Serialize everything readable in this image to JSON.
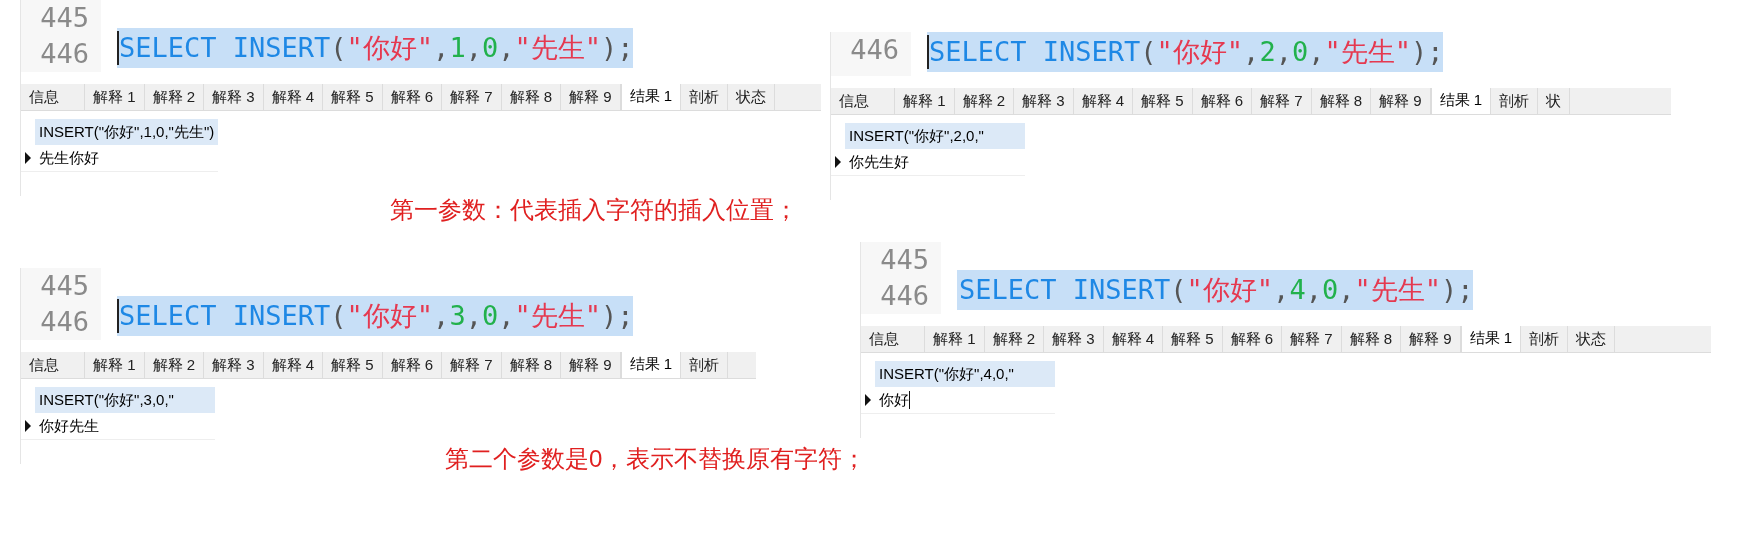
{
  "panels": [
    {
      "line_numbers": [
        "445",
        "446"
      ],
      "caret": true,
      "code": [
        {
          "kind": "keyword",
          "text": "SELECT INSERT"
        },
        {
          "kind": "punct",
          "text": "("
        },
        {
          "kind": "string",
          "text": "\"你好\""
        },
        {
          "kind": "punct",
          "text": ","
        },
        {
          "kind": "number",
          "text": "1"
        },
        {
          "kind": "punct",
          "text": ","
        },
        {
          "kind": "number",
          "text": "0"
        },
        {
          "kind": "punct",
          "text": ","
        },
        {
          "kind": "string",
          "text": "\"先生\""
        },
        {
          "kind": "punct",
          "text": ");"
        }
      ],
      "tabs": [
        {
          "label": "信息",
          "selected": false
        },
        {
          "label": "解释 1",
          "selected": false
        },
        {
          "label": "解释 2",
          "selected": false
        },
        {
          "label": "解释 3",
          "selected": false
        },
        {
          "label": "解释 4",
          "selected": false
        },
        {
          "label": "解释 5",
          "selected": false
        },
        {
          "label": "解释 6",
          "selected": false
        },
        {
          "label": "解释 7",
          "selected": false
        },
        {
          "label": "解释 8",
          "selected": false
        },
        {
          "label": "解释 9",
          "selected": false
        },
        {
          "label": "结果 1",
          "selected": true
        },
        {
          "label": "剖析",
          "selected": false
        },
        {
          "label": "状态",
          "selected": false
        }
      ],
      "result": {
        "column": "INSERT(\"你好\",1,0,\"先生\")",
        "value": "先生你好",
        "cursor": false
      }
    },
    {
      "line_numbers": [
        "446"
      ],
      "caret": true,
      "code": [
        {
          "kind": "keyword",
          "text": "SELECT INSERT"
        },
        {
          "kind": "punct",
          "text": "("
        },
        {
          "kind": "string",
          "text": "\"你好\""
        },
        {
          "kind": "punct",
          "text": ","
        },
        {
          "kind": "number",
          "text": "2"
        },
        {
          "kind": "punct",
          "text": ","
        },
        {
          "kind": "number",
          "text": "0"
        },
        {
          "kind": "punct",
          "text": ","
        },
        {
          "kind": "string",
          "text": "\"先生\""
        },
        {
          "kind": "punct",
          "text": ");"
        }
      ],
      "tabs": [
        {
          "label": "信息",
          "selected": false
        },
        {
          "label": "解释 1",
          "selected": false
        },
        {
          "label": "解释 2",
          "selected": false
        },
        {
          "label": "解释 3",
          "selected": false
        },
        {
          "label": "解释 4",
          "selected": false
        },
        {
          "label": "解释 5",
          "selected": false
        },
        {
          "label": "解释 6",
          "selected": false
        },
        {
          "label": "解释 7",
          "selected": false
        },
        {
          "label": "解释 8",
          "selected": false
        },
        {
          "label": "解释 9",
          "selected": false
        },
        {
          "label": "结果 1",
          "selected": true
        },
        {
          "label": "剖析",
          "selected": false
        },
        {
          "label": "状",
          "selected": false
        }
      ],
      "result": {
        "column": "INSERT(\"你好\",2,0,\"",
        "value": "你先生好",
        "cursor": false
      }
    },
    {
      "line_numbers": [
        "445",
        "446"
      ],
      "caret": true,
      "code": [
        {
          "kind": "keyword",
          "text": "SELECT INSERT"
        },
        {
          "kind": "punct",
          "text": "("
        },
        {
          "kind": "string",
          "text": "\"你好\""
        },
        {
          "kind": "punct",
          "text": ","
        },
        {
          "kind": "number",
          "text": "3"
        },
        {
          "kind": "punct",
          "text": ","
        },
        {
          "kind": "number",
          "text": "0"
        },
        {
          "kind": "punct",
          "text": ","
        },
        {
          "kind": "string",
          "text": "\"先生\""
        },
        {
          "kind": "punct",
          "text": ");"
        }
      ],
      "tabs": [
        {
          "label": "信息",
          "selected": false
        },
        {
          "label": "解释 1",
          "selected": false
        },
        {
          "label": "解释 2",
          "selected": false
        },
        {
          "label": "解释 3",
          "selected": false
        },
        {
          "label": "解释 4",
          "selected": false
        },
        {
          "label": "解释 5",
          "selected": false
        },
        {
          "label": "解释 6",
          "selected": false
        },
        {
          "label": "解释 7",
          "selected": false
        },
        {
          "label": "解释 8",
          "selected": false
        },
        {
          "label": "解释 9",
          "selected": false
        },
        {
          "label": "结果 1",
          "selected": true
        },
        {
          "label": "剖析",
          "selected": false
        }
      ],
      "result": {
        "column": "INSERT(\"你好\",3,0,\"",
        "value": "你好先生",
        "cursor": false
      }
    },
    {
      "line_numbers": [
        "445",
        "446"
      ],
      "caret": false,
      "code": [
        {
          "kind": "keyword",
          "text": "SELECT INSERT"
        },
        {
          "kind": "punct",
          "text": "("
        },
        {
          "kind": "string",
          "text": "\"你好\""
        },
        {
          "kind": "punct",
          "text": ","
        },
        {
          "kind": "number",
          "text": "4"
        },
        {
          "kind": "punct",
          "text": ","
        },
        {
          "kind": "number",
          "text": "0"
        },
        {
          "kind": "punct",
          "text": ","
        },
        {
          "kind": "string",
          "text": "\"先生\""
        },
        {
          "kind": "punct",
          "text": ");"
        }
      ],
      "tabs": [
        {
          "label": "信息",
          "selected": false
        },
        {
          "label": "解释 1",
          "selected": false
        },
        {
          "label": "解释 2",
          "selected": false
        },
        {
          "label": "解释 3",
          "selected": false
        },
        {
          "label": "解释 4",
          "selected": false
        },
        {
          "label": "解释 5",
          "selected": false
        },
        {
          "label": "解释 6",
          "selected": false
        },
        {
          "label": "解释 7",
          "selected": false
        },
        {
          "label": "解释 8",
          "selected": false
        },
        {
          "label": "解释 9",
          "selected": false
        },
        {
          "label": "结果 1",
          "selected": true
        },
        {
          "label": "剖析",
          "selected": false
        },
        {
          "label": "状态",
          "selected": false
        }
      ],
      "result": {
        "column": "INSERT(\"你好\",4,0,\"",
        "value": "你好",
        "cursor": true
      }
    }
  ],
  "annotations": [
    "第一参数：代表插入字符的插入位置；",
    "第二个参数是0，表示不替换原有字符；"
  ]
}
